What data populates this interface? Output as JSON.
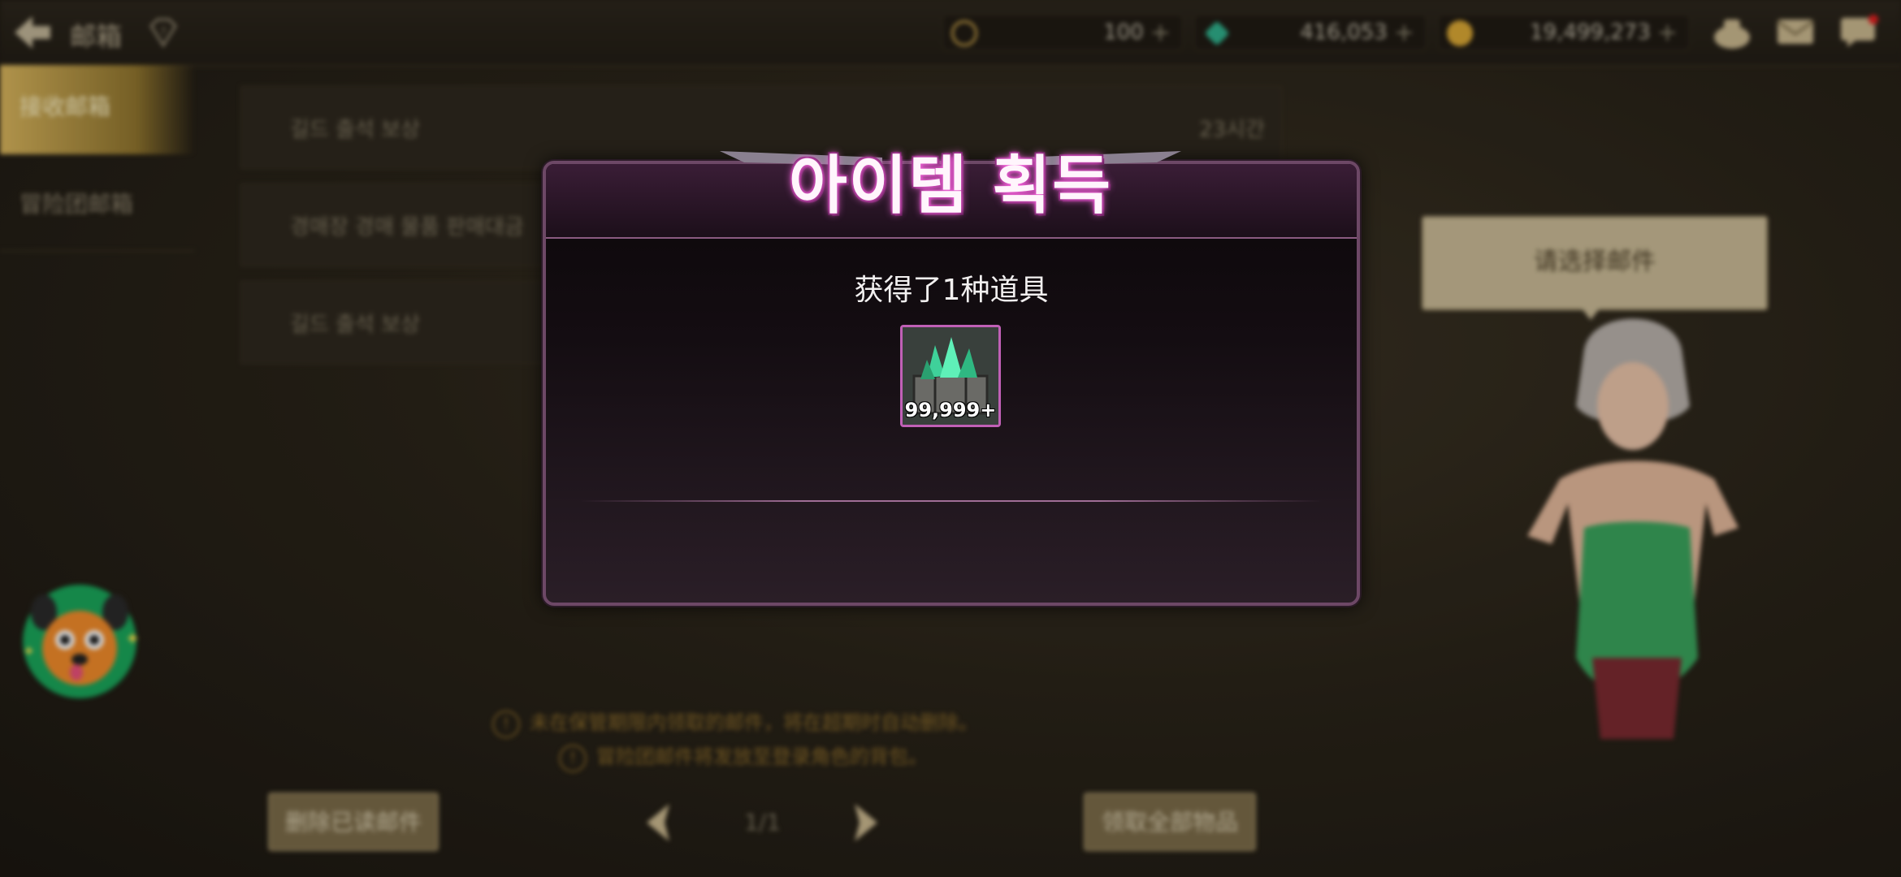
{
  "topbar": {
    "title": "邮箱",
    "currencies": [
      {
        "icon": "moon-coin-icon",
        "value": "100",
        "color": "#c8a24a"
      },
      {
        "icon": "green-crystal-icon",
        "value": "416,053",
        "color": "#2fae8a"
      },
      {
        "icon": "gold-coin-icon",
        "value": "19,499,273",
        "color": "#d8a634"
      }
    ]
  },
  "sidebar": {
    "tabs": [
      {
        "label": "接收邮箱",
        "active": true
      },
      {
        "label": "冒险团邮箱",
        "active": false
      }
    ]
  },
  "mail_list": [
    {
      "title": "길드 출석 보상",
      "time": "23시간"
    },
    {
      "title": "경매장 경매 물품 판매대금",
      "time": ""
    },
    {
      "title": "길드 출석 보상",
      "time": ""
    }
  ],
  "notices": [
    "未在保管期限内领取的邮件，将在超期时自动删除。",
    "冒险团邮件将发放至登录角色的背包。"
  ],
  "buttons": {
    "delete_read": "删除已读邮件",
    "claim_all": "领取全部物品"
  },
  "pager": {
    "text": "1/1"
  },
  "tooltip": {
    "text": "请选择邮件"
  },
  "modal": {
    "title": "아이템 획득",
    "message": "获得了1种道具",
    "item": {
      "icon": "green-crystal-chest-icon",
      "quantity": "99,999+"
    }
  },
  "colors": {
    "accent_gold": "#d7b45c",
    "modal_border": "#6d4866",
    "title_glow": "#ff6ee6"
  }
}
